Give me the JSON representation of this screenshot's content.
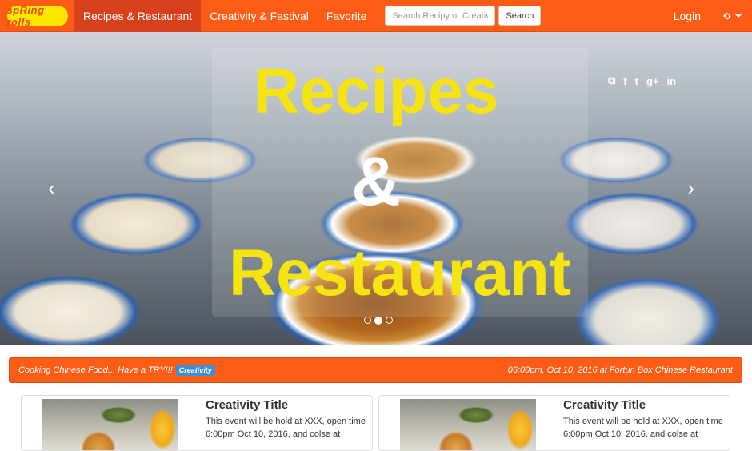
{
  "brand": {
    "logo_text": "spRing rolls",
    "color": "#ffe600"
  },
  "colors": {
    "accent": "#fc5c15",
    "active_tab": "#d8401d",
    "badge": "#3a8fd8",
    "hero_text": "#f5e312"
  },
  "nav": {
    "items": [
      {
        "label": "Recipes & Restaurant",
        "active": true
      },
      {
        "label": "Creativity & Fastival",
        "active": false
      },
      {
        "label": "Favorite",
        "active": false
      }
    ],
    "search_placeholder": "Search Recipy or Creativity",
    "search_button": "Search",
    "login": "Login",
    "settings_icon": "gear-icon"
  },
  "hero": {
    "line1": "Recipes",
    "amp": "&",
    "line3": "Restaurant",
    "left_arrow": "‹",
    "right_arrow": "›",
    "social_icons": [
      "rss-icon",
      "facebook-icon",
      "twitter-icon",
      "google-plus-icon",
      "linkedin-icon"
    ],
    "social_glyphs": [
      "⧉",
      "f",
      "t",
      "g+",
      "in"
    ],
    "slides_count": 3,
    "active_slide": 2
  },
  "banner": {
    "left_text": "Cooking Chinese Food... Have a TRY!!!",
    "badge": "Creativity",
    "right_text": "06:00pm, Oct 10, 2016 at Fortun Box Chinese Restaurant"
  },
  "cards": [
    {
      "title": "Creativity Title",
      "text": "This event will be hold at XXX, open time 6:00pm Oct 10, 2016, and colse at"
    },
    {
      "title": "Creativity Title",
      "text": "This event will be hold at XXX, open time 6:00pm Oct 10, 2016, and colse at"
    }
  ]
}
